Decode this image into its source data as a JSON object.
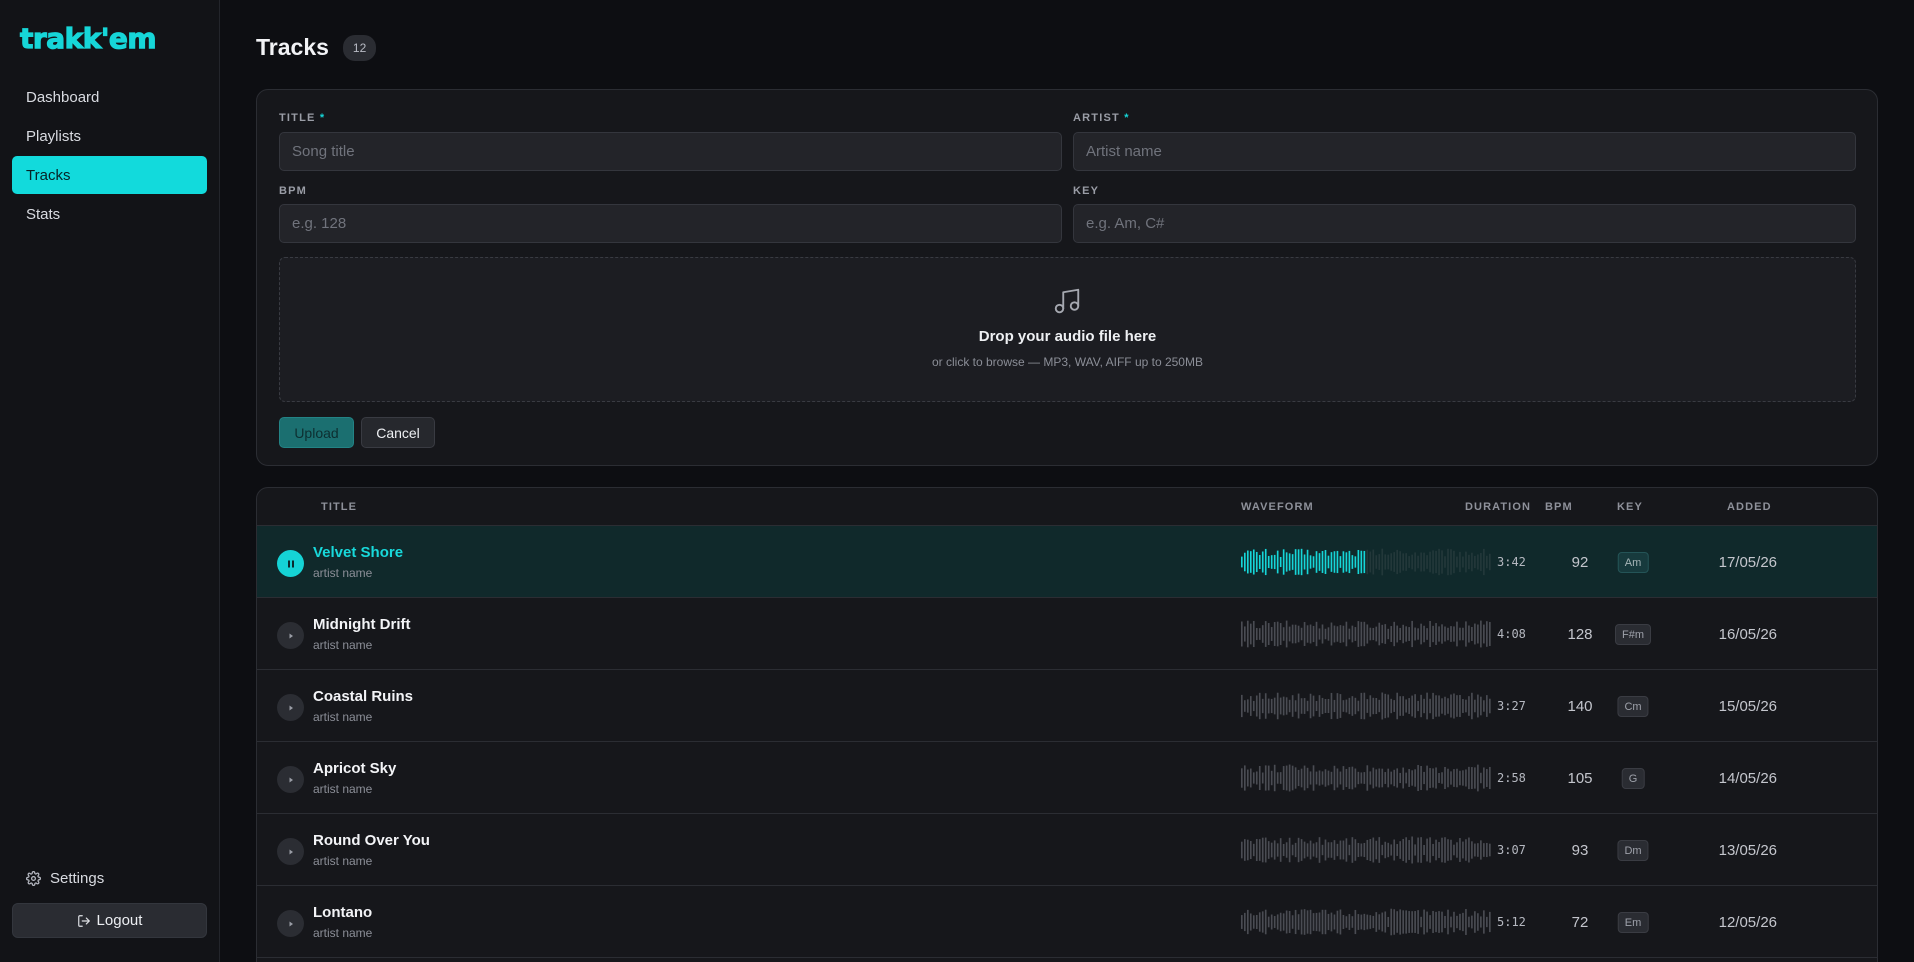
{
  "app": {
    "logo": "trakk'em"
  },
  "sidebar": {
    "items": [
      {
        "label": "Dashboard",
        "active": false
      },
      {
        "label": "Playlists",
        "active": false
      },
      {
        "label": "Tracks",
        "active": true
      },
      {
        "label": "Stats",
        "active": false
      }
    ],
    "settings_label": "Settings",
    "logout_label": "Logout"
  },
  "header": {
    "title": "Tracks",
    "count": "12"
  },
  "form": {
    "title_label": "TITLE",
    "title_placeholder": "Song title",
    "artist_label": "ARTIST",
    "artist_placeholder": "Artist name",
    "required_mark": "*",
    "bpm_label": "BPM",
    "bpm_placeholder": "e.g. 128",
    "key_label": "KEY",
    "key_placeholder": "e.g. Am, C#",
    "drop_title": "Drop your audio file here",
    "drop_subtitle": "or click to browse — MP3, WAV, AIFF up to 250MB",
    "upload_label": "Upload",
    "cancel_label": "Cancel"
  },
  "table": {
    "columns": {
      "title": "TITLE",
      "waveform": "WAVEFORM",
      "duration": "DURATION",
      "bpm": "BPM",
      "key": "KEY",
      "added": "ADDED"
    },
    "rows": [
      {
        "title": "Velvet Shore",
        "artist": "artist name",
        "duration": "3:42",
        "bpm": "92",
        "key": "Am",
        "added": "17/05/26",
        "playing": true,
        "progress": 0.5
      },
      {
        "title": "Midnight Drift",
        "artist": "artist name",
        "duration": "4:08",
        "bpm": "128",
        "key": "F#m",
        "added": "16/05/26",
        "playing": false,
        "progress": 0
      },
      {
        "title": "Coastal Ruins",
        "artist": "artist name",
        "duration": "3:27",
        "bpm": "140",
        "key": "Cm",
        "added": "15/05/26",
        "playing": false,
        "progress": 0
      },
      {
        "title": "Apricot Sky",
        "artist": "artist name",
        "duration": "2:58",
        "bpm": "105",
        "key": "G",
        "added": "14/05/26",
        "playing": false,
        "progress": 0
      },
      {
        "title": "Round Over You",
        "artist": "artist name",
        "duration": "3:07",
        "bpm": "93",
        "key": "Dm",
        "added": "13/05/26",
        "playing": false,
        "progress": 0
      },
      {
        "title": "Lontano",
        "artist": "artist name",
        "duration": "5:12",
        "bpm": "72",
        "key": "Em",
        "added": "12/05/26",
        "playing": false,
        "progress": 0
      }
    ]
  },
  "colors": {
    "accent": "#16d6d8",
    "background": "#0d0e12",
    "panel": "#16171b",
    "wave_idle": "#4a4c53"
  },
  "icons": {
    "settings": "gear-icon",
    "logout": "logout-icon",
    "drop": "music-note-icon",
    "play": "play-icon",
    "pause": "pause-icon"
  }
}
